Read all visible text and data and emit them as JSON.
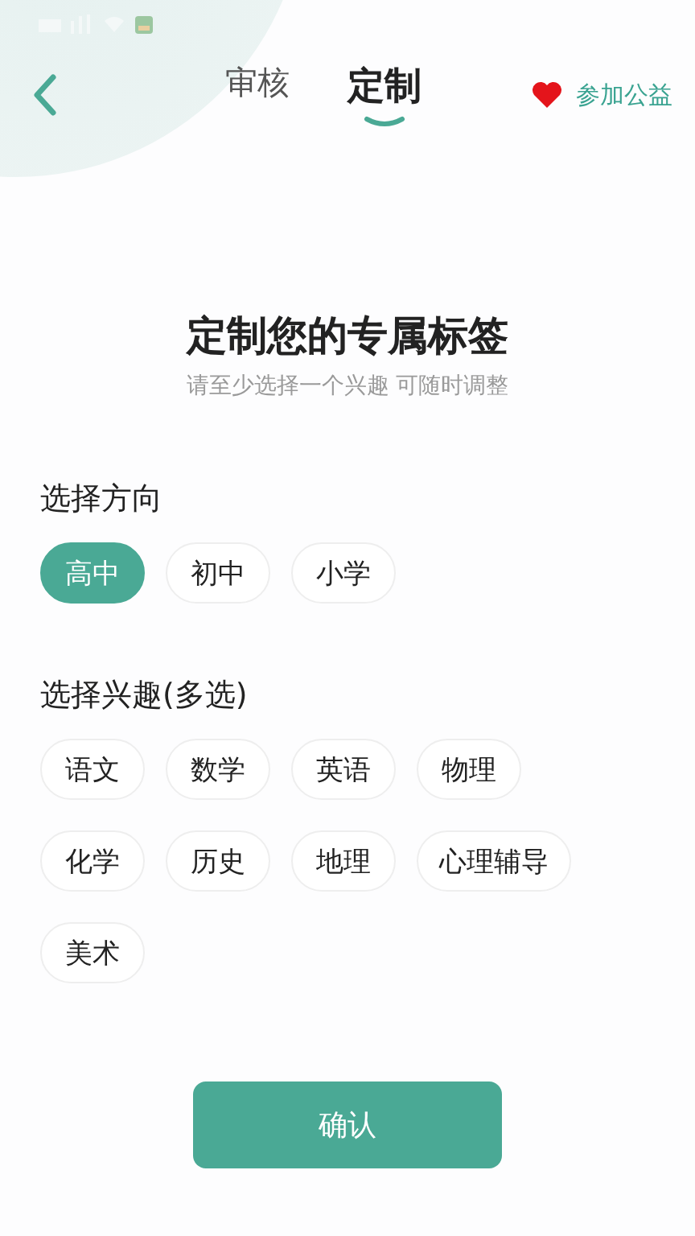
{
  "nav": {
    "tabs": [
      {
        "label": "审核",
        "selected": false
      },
      {
        "label": "定制",
        "selected": true
      }
    ],
    "charity_link": "参加公益"
  },
  "heading": {
    "title": "定制您的专属标签",
    "subtitle": "请至少选择一个兴趣 可随时调整"
  },
  "sections": [
    {
      "label": "选择方向",
      "chips": [
        {
          "label": "高中",
          "selected": true
        },
        {
          "label": "初中",
          "selected": false
        },
        {
          "label": "小学",
          "selected": false
        }
      ]
    },
    {
      "label": "选择兴趣(多选)",
      "chips": [
        {
          "label": "语文",
          "selected": false
        },
        {
          "label": "数学",
          "selected": false
        },
        {
          "label": "英语",
          "selected": false
        },
        {
          "label": "物理",
          "selected": false
        },
        {
          "label": "化学",
          "selected": false
        },
        {
          "label": "历史",
          "selected": false
        },
        {
          "label": "地理",
          "selected": false
        },
        {
          "label": "心理辅导",
          "selected": false
        },
        {
          "label": "美术",
          "selected": false
        }
      ]
    }
  ],
  "confirm_button": "确认"
}
